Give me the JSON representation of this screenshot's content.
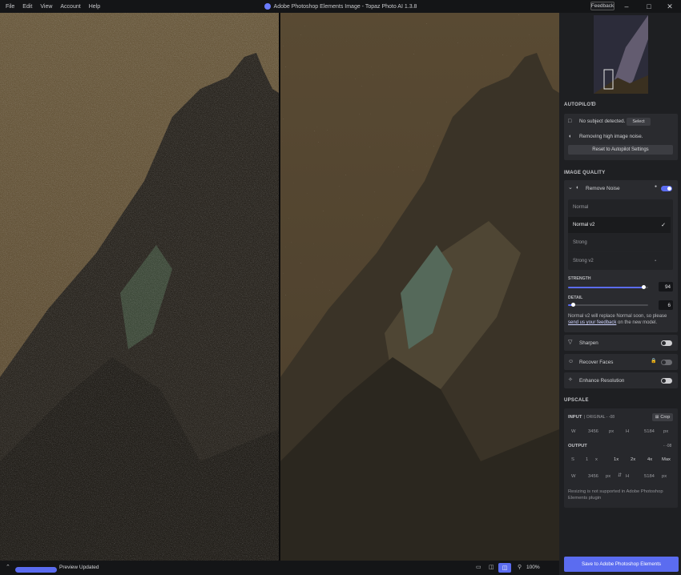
{
  "menu": [
    "File",
    "Edit",
    "View",
    "Account",
    "Help"
  ],
  "window_title": "Adobe Photoshop Elements Image - Topaz Photo AI 1.3.8",
  "feedback_label": "Feedback",
  "status": {
    "progress_fraction": 1.0,
    "text": "Preview Updated",
    "zoom": "100%"
  },
  "autopilot": {
    "label": "AUTOPILOT",
    "subject_text": "No subject detected.",
    "select_label": "Select",
    "noise_text": "Removing high image noise.",
    "reset_label": "Reset to Autopilot Settings"
  },
  "image_quality": {
    "label": "IMAGE QUALITY",
    "remove_noise": {
      "label": "Remove Noise",
      "enabled": true,
      "models": [
        "Normal",
        "Normal v2",
        "Strong",
        "Strong v2"
      ],
      "selected": "Normal v2",
      "strength_label": "STRENGTH",
      "strength_value": "94",
      "strength_fraction": 0.94,
      "detail_label": "DETAIL",
      "detail_value": "6",
      "detail_fraction": 0.06,
      "note_prefix": "Normal v2 will replace Normal soon, so please ",
      "note_link": "send us your feedback",
      "note_suffix": " on the new model."
    },
    "sharpen": {
      "label": "Sharpen",
      "enabled": false
    },
    "recover_faces": {
      "label": "Recover Faces",
      "enabled": false
    },
    "enhance_resolution": {
      "label": "Enhance Resolution",
      "enabled": false
    }
  },
  "upscale": {
    "label": "UPSCALE",
    "input_label": "INPUT",
    "input_sub": "| ORIGINAL - -08",
    "crop_label": "Crop",
    "w_label": "W",
    "w_value": "3456",
    "h_label": "H",
    "h_value": "5184",
    "unit": "px",
    "output_label": "OUTPUT",
    "output_sub": "- -08",
    "s_label": "S",
    "s_value": "1",
    "s_unit": "x",
    "scale_options": [
      "1x",
      "2x",
      "4x",
      "Max"
    ],
    "out_w": "3456",
    "out_h": "5184",
    "note": "Resizing is not supported in Adobe Photoshop Elements plugin"
  },
  "save_label": "Save to Adobe Photoshop Elements"
}
